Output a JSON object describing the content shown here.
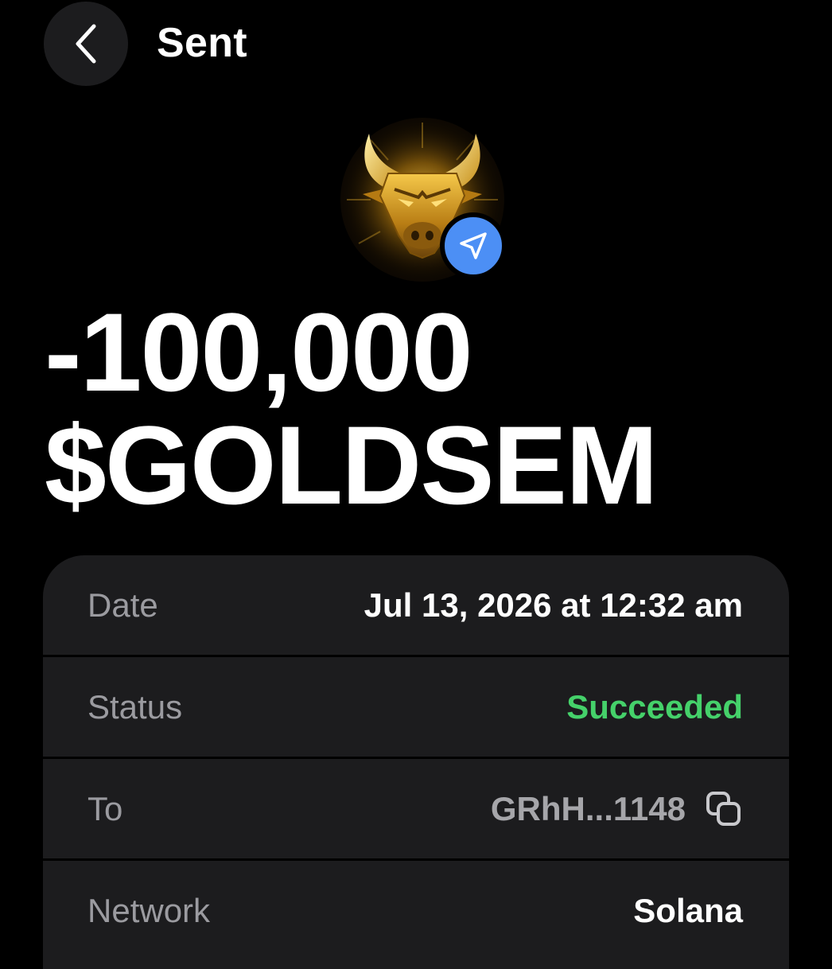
{
  "header": {
    "title": "Sent",
    "back_icon": "chevron-left-icon"
  },
  "token": {
    "logo_icon": "golden-bull-icon",
    "badge_icon": "send-arrow-icon",
    "badge_color": "#4c8ff5"
  },
  "amount": {
    "value": "-100,000",
    "symbol": "$GOLDSEM"
  },
  "details": {
    "date": {
      "label": "Date",
      "value": "Jul 13, 2026 at 12:32 am"
    },
    "status": {
      "label": "Status",
      "value": "Succeeded",
      "color": "#45d16a"
    },
    "to": {
      "label": "To",
      "value": "GRhH...1148",
      "copy_icon": "copy-icon"
    },
    "network": {
      "label": "Network",
      "value": "Solana"
    }
  },
  "colors": {
    "background": "#000000",
    "card": "#1c1c1e",
    "label": "#9b9ba0",
    "accent_blue": "#4c8ff5",
    "success_green": "#45d16a",
    "gold": "#d9a21c"
  }
}
